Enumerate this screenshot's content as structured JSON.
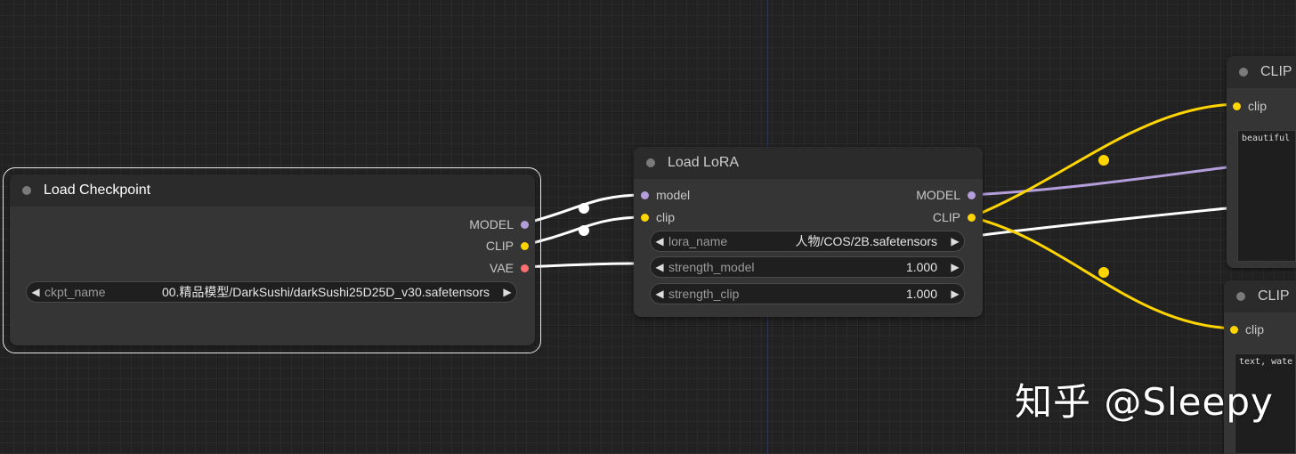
{
  "colors": {
    "model": "#b39ddb",
    "clip": "#ffd500",
    "vae": "#ff6e6e",
    "wire_white": "#ffffff",
    "node_bg": "#353535",
    "canvas_bg": "#222222"
  },
  "load_checkpoint": {
    "title": "Load Checkpoint",
    "outputs": [
      "MODEL",
      "CLIP",
      "VAE"
    ],
    "widget": {
      "label": "ckpt_name",
      "value": "00.精品模型/DarkSushi/darkSushi25D25D_v30.safetensors"
    }
  },
  "load_lora": {
    "title": "Load LoRA",
    "inputs": [
      "model",
      "clip"
    ],
    "outputs": [
      "MODEL",
      "CLIP"
    ],
    "widgets": [
      {
        "label": "lora_name",
        "value": "人物/COS/2B.safetensors"
      },
      {
        "label": "strength_model",
        "value": "1.000"
      },
      {
        "label": "strength_clip",
        "value": "1.000"
      }
    ]
  },
  "clip_top": {
    "title": "CLIP",
    "input": "clip",
    "text": "beautiful"
  },
  "clip_bottom": {
    "title": "CLIP",
    "input": "clip",
    "text": "text, wate"
  },
  "watermark": "知乎 @Sleepy"
}
